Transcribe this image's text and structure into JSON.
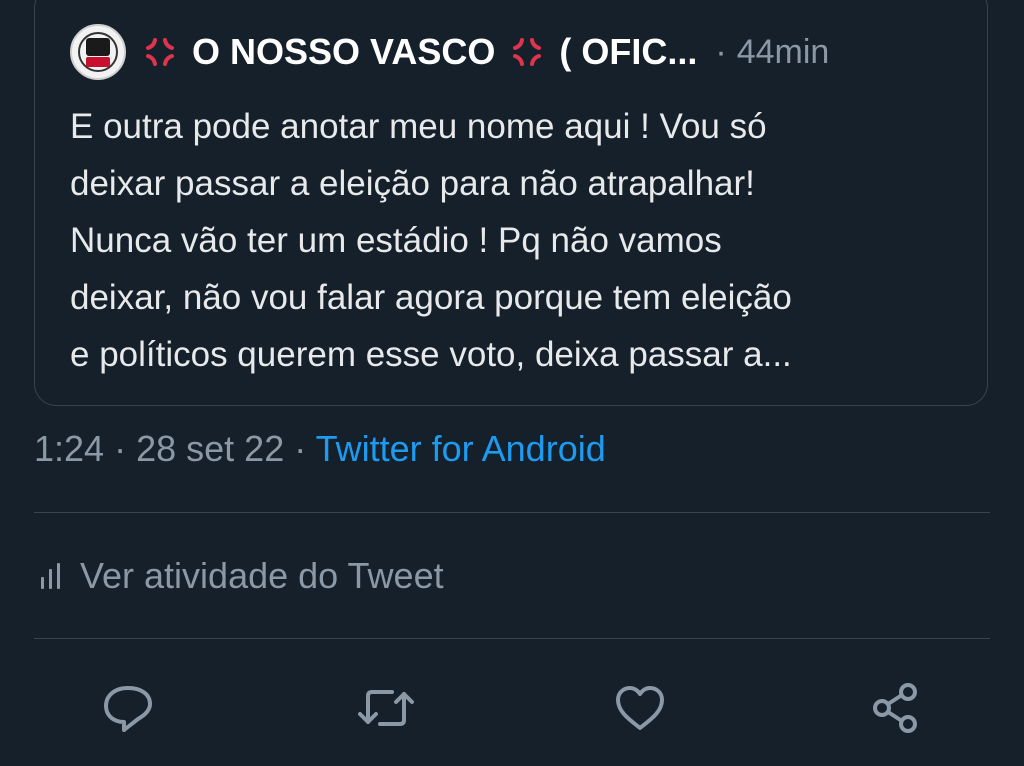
{
  "quote": {
    "author_name": "O NOSSO VASCO",
    "author_suffix": "( OFIC...",
    "separator": "·",
    "time_ago": "44min",
    "text_lines": [
      "E outra pode anotar meu nome aqui ! Vou só",
      "deixar passar a eleição para não atrapalhar!",
      "Nunca vão ter um estádio ! Pq não vamos",
      "deixar, não vou falar agora porque tem eleição",
      "e políticos querem esse voto, deixa passar a..."
    ],
    "emoji_icon": "anger-symbol-icon"
  },
  "meta": {
    "time": "1:24",
    "sep1": "·",
    "date": "28 set 22",
    "sep2": "·",
    "source": "Twitter for Android"
  },
  "activity": {
    "label": "Ver atividade do Tweet",
    "icon": "bar-chart-icon"
  },
  "actions": [
    {
      "name": "reply",
      "icon": "speech-bubble-icon"
    },
    {
      "name": "retweet",
      "icon": "retweet-icon"
    },
    {
      "name": "like",
      "icon": "heart-icon"
    },
    {
      "name": "share",
      "icon": "share-icon"
    }
  ],
  "colors": {
    "background": "#15202b",
    "border": "#38444d",
    "secondary_text": "#8b98a5",
    "link": "#1d9bf0",
    "anger": "#e0334d"
  }
}
